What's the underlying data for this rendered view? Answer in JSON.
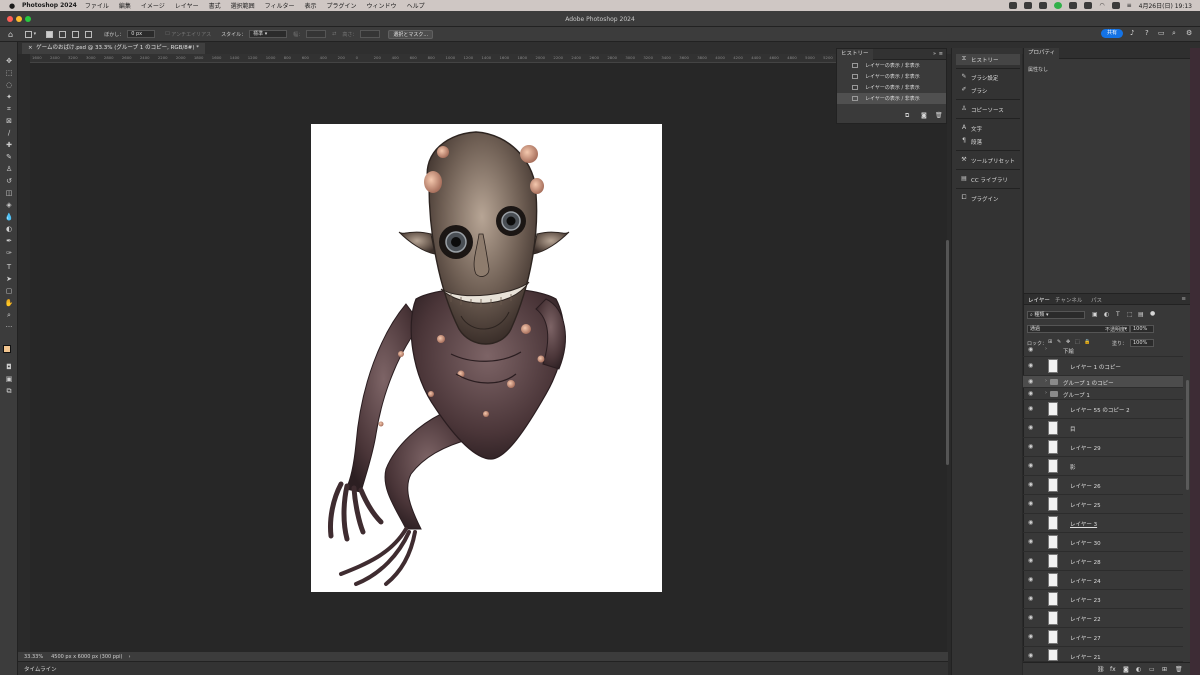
{
  "menubar": {
    "app": "Photoshop 2024",
    "items": [
      "ファイル",
      "編集",
      "イメージ",
      "レイヤー",
      "書式",
      "選択範囲",
      "フィルター",
      "表示",
      "プラグイン",
      "ウィンドウ",
      "ヘルプ"
    ],
    "datetime": "4月26日(日)  19:13"
  },
  "window": {
    "title": "Adobe Photoshop 2024"
  },
  "options": {
    "feather_label": "ぼかし：",
    "feather_value": "0 px",
    "antialias": "アンチエイリアス",
    "style_label": "スタイル：",
    "style_value": "標準",
    "width_label": "幅：",
    "height_label": "高さ：",
    "select_mask": "選択とマスク...",
    "share": "共有"
  },
  "document": {
    "tab_title": "ゲームのおばけ.psd @ 33.3% (グループ 1 のコピー, RGB/8#) *",
    "zoom": "33.33%",
    "info": "4500 px x 6000 px (300 ppi)"
  },
  "ruler_ticks": [
    "1600",
    "2400",
    "3200",
    "3000",
    "2800",
    "2600",
    "2400",
    "2200",
    "2000",
    "1800",
    "1600",
    "1400",
    "1200",
    "1000",
    "800",
    "600",
    "400",
    "200",
    "0",
    "200",
    "400",
    "600",
    "800",
    "1000",
    "1200",
    "1400",
    "1600",
    "1800",
    "2000",
    "2200",
    "2400",
    "2600",
    "2800",
    "3000",
    "3200",
    "3400",
    "3600",
    "3800",
    "4000",
    "4200",
    "4400",
    "4600",
    "4800",
    "5000",
    "5200",
    "5400",
    "5600",
    "5800",
    "6000",
    "6200",
    "6400"
  ],
  "history": {
    "title": "ヒストリー",
    "items": [
      "レイヤーの表示 / 非表示",
      "レイヤーの表示 / 非表示",
      "レイヤーの表示 / 非表示",
      "レイヤーの表示 / 非表示"
    ]
  },
  "dock": {
    "history": "ヒストリー",
    "brush_settings": "ブラシ設定",
    "brush": "ブラシ",
    "clone_source": "コピーソース",
    "character": "文字",
    "paragraph": "段落",
    "tool_presets": "ツールプリセット",
    "cc_libraries": "CC ライブラリ",
    "plugins": "プラグイン"
  },
  "properties": {
    "title": "プロパティ",
    "empty": "属性なし"
  },
  "layers_panel": {
    "tabs": [
      "レイヤー",
      "チャンネル",
      "パス"
    ],
    "filter": "種類",
    "blend": "通過",
    "opacity_label": "不透明度：",
    "opacity": "100%",
    "lock_label": "ロック：",
    "fill_label": "塗り：",
    "fill": "100%",
    "layers": [
      "下絵",
      "レイヤー 1 のコピー",
      "グループ 1 のコピー",
      "グループ 1",
      "レイヤー 55 のコピー 2",
      "目",
      "レイヤー 29",
      "影",
      "レイヤー 26",
      "レイヤー 25",
      "レイヤー 3",
      "レイヤー 30",
      "レイヤー 28",
      "レイヤー 24",
      "レイヤー 23",
      "レイヤー 22",
      "レイヤー 27",
      "レイヤー 21"
    ]
  },
  "timeline": {
    "label": "タイムライン"
  },
  "colors": {
    "accent": "#1473e6",
    "canvas_bg": "#272727",
    "panel_bg": "#383838",
    "foreground_swatch": "#f2c58f",
    "background_swatch": "#ffffff"
  }
}
